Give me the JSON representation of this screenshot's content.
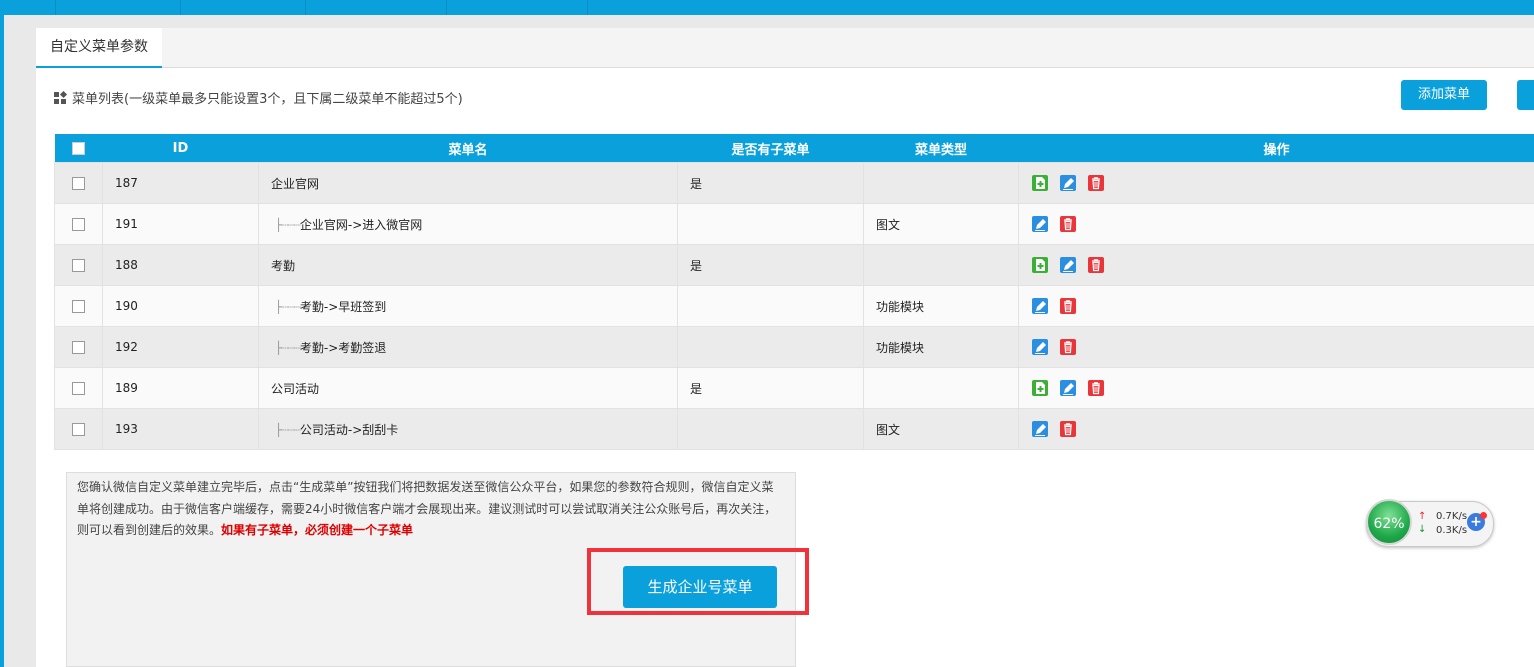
{
  "tab": {
    "label": "自定义菜单参数"
  },
  "list": {
    "title": "菜单列表(一级菜单最多只能设置3个，且下属二级菜单不能超过5个)"
  },
  "buttons": {
    "add_menu": "添加菜单",
    "generate": "生成企业号菜单"
  },
  "table": {
    "headers": [
      "ID",
      "菜单名",
      "是否有子菜单",
      "菜单类型",
      "操作"
    ],
    "rows": [
      {
        "id": "187",
        "name": "企业官网",
        "has_sub": "是",
        "type": "",
        "level": 1
      },
      {
        "id": "191",
        "name": "企业官网->进入微官网",
        "has_sub": "",
        "type": "图文",
        "level": 2
      },
      {
        "id": "188",
        "name": "考勤",
        "has_sub": "是",
        "type": "",
        "level": 1
      },
      {
        "id": "190",
        "name": "考勤->早班签到",
        "has_sub": "",
        "type": "功能模块",
        "level": 2
      },
      {
        "id": "192",
        "name": "考勤->考勤签退",
        "has_sub": "",
        "type": "功能模块",
        "level": 2
      },
      {
        "id": "189",
        "name": "公司活动",
        "has_sub": "是",
        "type": "",
        "level": 1
      },
      {
        "id": "193",
        "name": "公司活动->刮刮卡",
        "has_sub": "",
        "type": "图文",
        "level": 2
      }
    ]
  },
  "notice": {
    "text": "您确认微信自定义菜单建立完毕后，点击“生成菜单”按钮我们将把数据发送至微信公众平台，如果您的参数符合规则，微信自定义菜单将创建成功。由于微信客户端缓存，需要24小时微信客户端才会展现出来。建议测试时可以尝试取消关注公众账号后，再次关注，则可以看到创建后的效果。",
    "warning": "如果有子菜单，必须创建一个子菜单"
  },
  "net_widget": {
    "percent": "62%",
    "up": "0.7K/s",
    "down": "0.3K/s"
  },
  "colors": {
    "accent": "#0aa0dc",
    "highlight_border": "#f0333a",
    "warning": "#dd0000"
  }
}
